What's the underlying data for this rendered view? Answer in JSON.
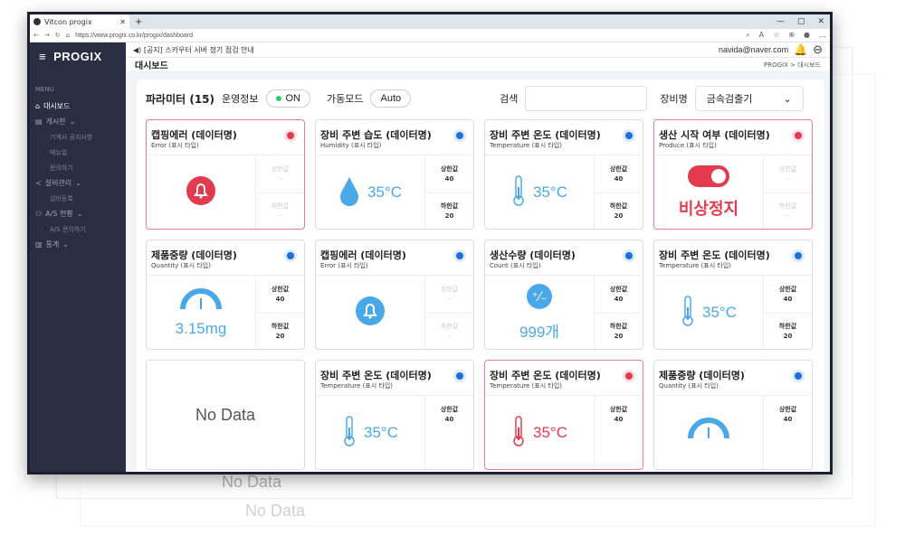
{
  "browser": {
    "tab_title": "Vitcon progix",
    "url": "https://www.progix.co.kr/progix/dashboard"
  },
  "sidebar": {
    "logo": "PROGIX",
    "menu_heading": "MENU",
    "items": [
      {
        "label": "대시보드"
      },
      {
        "label": "게시판"
      },
      {
        "label": "기계사 공지사항",
        "sub": true
      },
      {
        "label": "매뉴얼",
        "sub": true
      },
      {
        "label": "문의하기",
        "sub": true
      },
      {
        "label": "설비관리"
      },
      {
        "label": "설비등록",
        "sub": true
      },
      {
        "label": "A/S 현황"
      },
      {
        "label": "A/S 문의하기",
        "sub": true
      },
      {
        "label": "통계"
      }
    ]
  },
  "topbar": {
    "notice": "◀) [공지] 스카우터 서버 정기 점검 안내",
    "user_email": "navida@naver.com"
  },
  "page": {
    "title": "대시보드",
    "breadcrumb": "PROGIX  >  대시보드"
  },
  "filter": {
    "param_label": "파라미터 (15)",
    "oper_label": "운영정보",
    "oper_value": "ON",
    "mode_label": "가동모드",
    "mode_value": "Auto",
    "search_label": "검색",
    "equip_label": "장비명",
    "equip_value": "금속검출기"
  },
  "cards": [
    {
      "title": "캡핑에러 (데이터명)",
      "sub": "Error (표시 타입)",
      "alert": true,
      "value": "",
      "upper_label": "상한값",
      "upper": "--",
      "lower_label": "하한값",
      "lower": "--",
      "icon": "bell-icon"
    },
    {
      "title": "장비 주변 습도 (데이터명)",
      "sub": "Humidity (표시 타입)",
      "alert": false,
      "value": "35°C",
      "upper_label": "상한값",
      "upper": "40",
      "lower_label": "하한값",
      "lower": "20",
      "icon": "droplet-icon"
    },
    {
      "title": "장비 주변 온도 (데이터명)",
      "sub": "Temperature (표시 타입)",
      "alert": false,
      "value": "35°C",
      "upper_label": "상한값",
      "upper": "40",
      "lower_label": "하한값",
      "lower": "20",
      "icon": "thermometer-icon"
    },
    {
      "title": "생산 시작 여부 (데이터명)",
      "sub": "Produce (표시 타입)",
      "alert": true,
      "value": "비상정지",
      "upper_label": "상한값",
      "upper": "--",
      "lower_label": "하한값",
      "lower": "--",
      "icon": "toggle-icon"
    },
    {
      "title": "제품중량 (데이터명)",
      "sub": "Quantity (표시 타입)",
      "alert": false,
      "value": "3.15mg",
      "upper_label": "상한값",
      "upper": "40",
      "lower_label": "하한값",
      "lower": "20",
      "icon": "gauge-icon"
    },
    {
      "title": "캡핑에러 (데이터명)",
      "sub": "Error (표시 타입)",
      "alert": false,
      "value": "",
      "upper_label": "상한값",
      "upper": "--",
      "lower_label": "하한값",
      "lower": "--",
      "icon": "bell-icon"
    },
    {
      "title": "생산수량 (데이터명)",
      "sub": "Count (표시 타입)",
      "alert": false,
      "value": "999개",
      "upper_label": "상한값",
      "upper": "40",
      "lower_label": "하한값",
      "lower": "20",
      "icon": "plus-minus-icon"
    },
    {
      "title": "장비 주변 온도 (데이터명)",
      "sub": "Temperature (표시 타입)",
      "alert": false,
      "value": "35°C",
      "upper_label": "상한값",
      "upper": "40",
      "lower_label": "하한값",
      "lower": "20",
      "icon": "thermometer-icon"
    },
    {
      "title": "",
      "sub": "",
      "alert": false,
      "value": "No Data",
      "nodata": true
    },
    {
      "title": "장비 주변 온도 (데이터명)",
      "sub": "Temperature (표시 타입)",
      "alert": false,
      "value": "35°C",
      "upper_label": "상한값",
      "upper": "40",
      "lower_label": "",
      "lower": "",
      "icon": "thermometer-icon"
    },
    {
      "title": "장비 주변 온도 (데이터명)",
      "sub": "Temperature (표시 타입)",
      "alert": true,
      "value": "35°C",
      "upper_label": "상한값",
      "upper": "40",
      "lower_label": "",
      "lower": "",
      "icon": "thermometer-icon"
    },
    {
      "title": "제품중량 (데이터명)",
      "sub": "Quantity (표시 타입)",
      "alert": false,
      "value": "",
      "upper_label": "상한값",
      "upper": "40",
      "lower_label": "",
      "lower": "",
      "icon": "gauge-icon"
    }
  ],
  "ghost": {
    "nodata1": "No Data",
    "nodata2": "No Data"
  },
  "colors": {
    "sidebar": "#2b2e42",
    "accent": "#3fa9f5",
    "alert": "#e23b4d",
    "value_blue": "#4aa8e8"
  }
}
